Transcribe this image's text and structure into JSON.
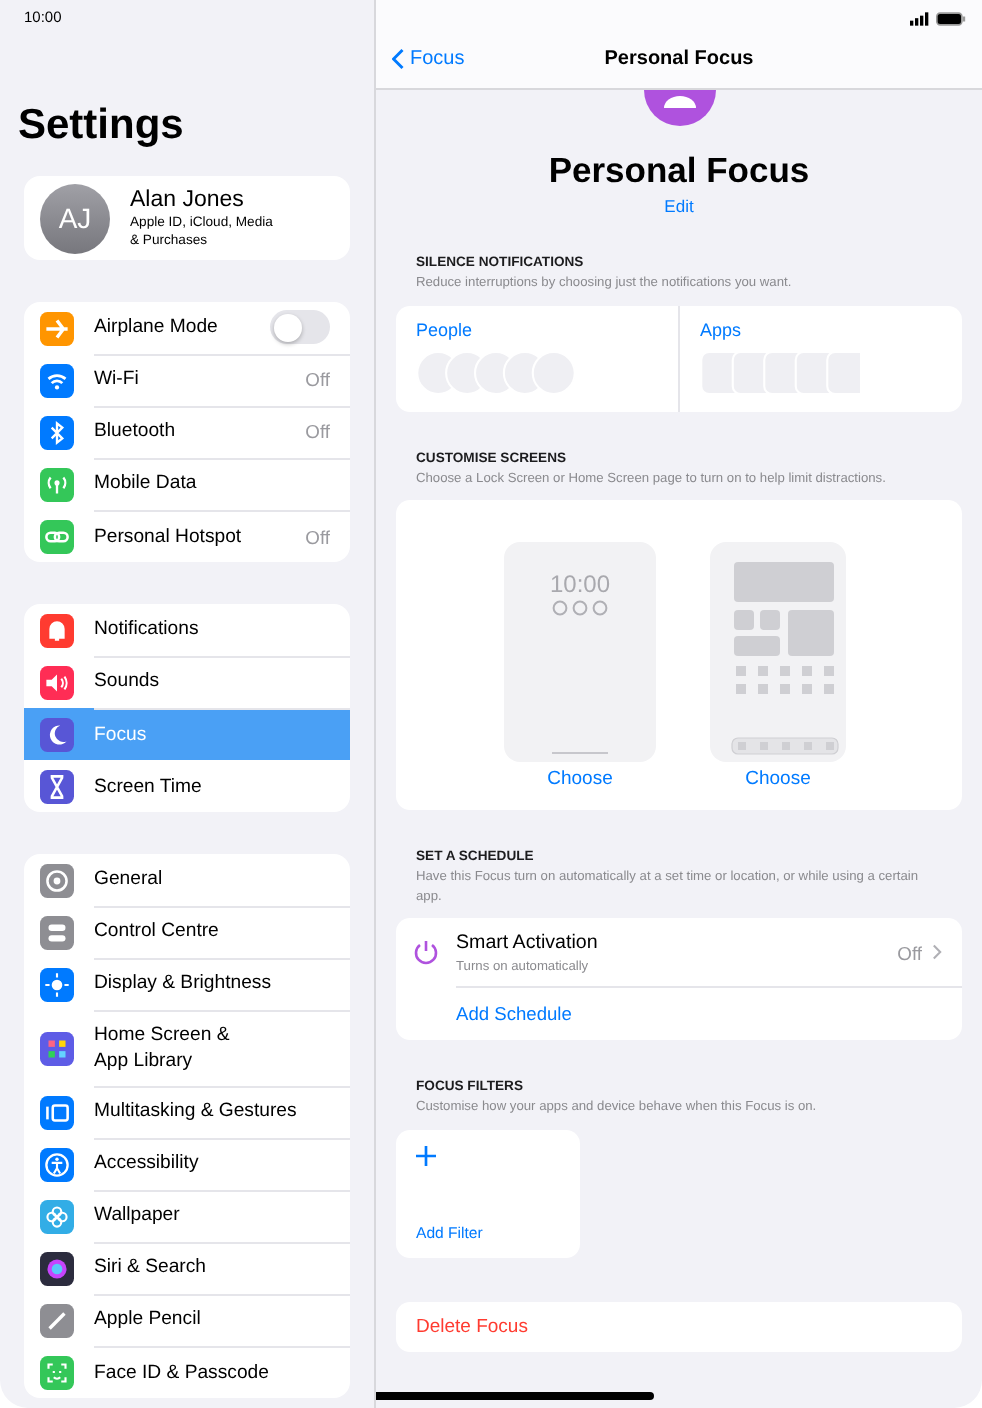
{
  "status_bar": {
    "time": "10:00"
  },
  "sidebar": {
    "title": "Settings",
    "profile": {
      "initials": "AJ",
      "name": "Alan Jones",
      "subtitle": "Apple ID, iCloud, Media\n& Purchases"
    },
    "groups": [
      {
        "items": [
          {
            "label": "Airplane Mode",
            "color": "#ff9500",
            "kind": "toggle",
            "on": false,
            "selected": false
          },
          {
            "label": "Wi-Fi",
            "color": "#007aff",
            "kind": "value",
            "value": "Off",
            "selected": false
          },
          {
            "label": "Bluetooth",
            "color": "#007aff",
            "kind": "value",
            "value": "Off",
            "selected": false
          },
          {
            "label": "Mobile Data",
            "color": "#34c759",
            "kind": "plain",
            "selected": false
          },
          {
            "label": "Personal Hotspot",
            "color": "#34c759",
            "kind": "value",
            "value": "Off",
            "selected": false
          }
        ]
      },
      {
        "items": [
          {
            "label": "Notifications",
            "color": "#ff3b30",
            "kind": "plain",
            "selected": false
          },
          {
            "label": "Sounds",
            "color": "#ff2d55",
            "kind": "plain",
            "selected": false
          },
          {
            "label": "Focus",
            "color": "#5856d6",
            "kind": "plain",
            "selected": true
          },
          {
            "label": "Screen Time",
            "color": "#5856d6",
            "kind": "plain",
            "selected": false
          }
        ]
      },
      {
        "items": [
          {
            "label": "General",
            "color": "#8e8e93",
            "kind": "plain",
            "selected": false
          },
          {
            "label": "Control Centre",
            "color": "#8e8e93",
            "kind": "plain",
            "selected": false
          },
          {
            "label": "Display & Brightness",
            "color": "#007aff",
            "kind": "plain",
            "selected": false
          },
          {
            "label": "Home Screen &\nApp Library",
            "color": "#5e5ce6",
            "kind": "plain",
            "selected": false
          },
          {
            "label": "Multitasking & Gestures",
            "color": "#007aff",
            "kind": "plain",
            "selected": false
          },
          {
            "label": "Accessibility",
            "color": "#007aff",
            "kind": "plain",
            "selected": false
          },
          {
            "label": "Wallpaper",
            "color": "#32ade6",
            "kind": "plain",
            "selected": false
          },
          {
            "label": "Siri & Search",
            "color": "#2c2c3e",
            "kind": "plain",
            "selected": false
          },
          {
            "label": "Apple Pencil",
            "color": "#8e8e93",
            "kind": "plain",
            "selected": false
          },
          {
            "label": "Face ID & Passcode",
            "color": "#34c759",
            "kind": "plain",
            "selected": false
          }
        ]
      }
    ]
  },
  "detail": {
    "nav": {
      "back": "Focus",
      "title": "Personal Focus"
    },
    "header": {
      "title": "Personal Focus",
      "edit": "Edit"
    },
    "silence": {
      "heading": "SILENCE NOTIFICATIONS",
      "description": "Reduce interruptions by choosing just the notifications you want.",
      "people": "People",
      "apps": "Apps"
    },
    "screens": {
      "heading": "CUSTOMISE SCREENS",
      "description": "Choose a Lock Screen or Home Screen page to turn on to help limit distractions.",
      "lock_time": "10:00",
      "choose": [
        "Choose",
        "Choose"
      ]
    },
    "schedule": {
      "heading": "SET A SCHEDULE",
      "description": "Have this Focus turn on automatically at a set time or location, or while using a certain app.",
      "title": "Smart Activation",
      "subtitle": "Turns on automatically",
      "value": "Off",
      "add": "Add Schedule"
    },
    "filters": {
      "heading": "FOCUS FILTERS",
      "description": "Customise how your apps and device behave when this Focus is on.",
      "add": "Add Filter"
    },
    "delete": "Delete Focus"
  }
}
